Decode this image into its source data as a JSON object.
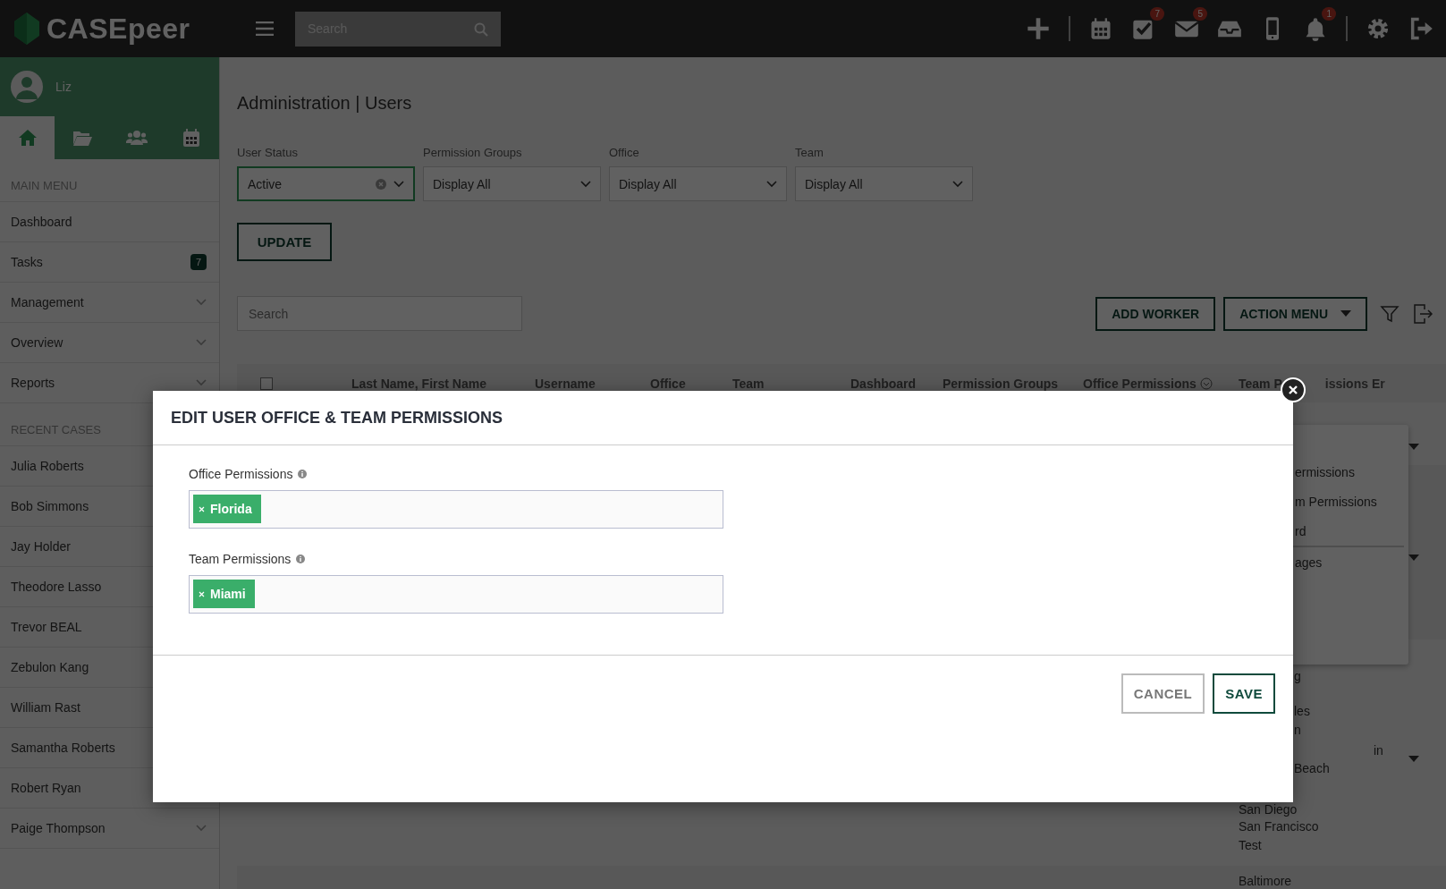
{
  "topbar": {
    "logo_text": "CASEpeer",
    "search": {
      "placeholder": "Search"
    },
    "actions": [
      {
        "kind": "add"
      },
      {
        "kind": "divider"
      },
      {
        "kind": "calendar"
      },
      {
        "kind": "tasks",
        "badge": "7"
      },
      {
        "kind": "mail",
        "badge": "5"
      },
      {
        "kind": "inbox"
      },
      {
        "kind": "phone"
      },
      {
        "kind": "bell",
        "badge": "1"
      },
      {
        "kind": "divider"
      },
      {
        "kind": "settings"
      },
      {
        "kind": "logout"
      }
    ]
  },
  "sidebar": {
    "user": "Liz",
    "tabs": [
      {
        "kind": "home",
        "selected": true
      },
      {
        "kind": "folder",
        "selected": false
      },
      {
        "kind": "people",
        "selected": false
      },
      {
        "kind": "calendar",
        "selected": false
      }
    ],
    "main_menu": {
      "heading": "MAIN MENU",
      "items": [
        {
          "label": "Dashboard",
          "expandable": false
        },
        {
          "label": "Tasks",
          "badge": "7",
          "expandable": false
        },
        {
          "label": "Management",
          "expandable": true
        },
        {
          "label": "Overview",
          "expandable": true
        },
        {
          "label": "Reports",
          "expandable": true
        }
      ]
    },
    "recent_cases": {
      "heading": "RECENT CASES",
      "items": [
        {
          "label": "Julia Roberts"
        },
        {
          "label": "Bob Simmons"
        },
        {
          "label": "Jay Holder"
        },
        {
          "label": "Theodore Lasso"
        },
        {
          "label": "Trevor BEAL"
        },
        {
          "label": "Zebulon Kang"
        },
        {
          "label": "William Rast"
        },
        {
          "label": "Samantha Roberts"
        },
        {
          "label": "Robert Ryan"
        },
        {
          "label": "Paige Thompson",
          "expandable": true
        }
      ]
    }
  },
  "page": {
    "title": "Administration | Users",
    "filters": [
      {
        "label": "User Status",
        "value": "Active",
        "clearable": true
      },
      {
        "label": "Permission Groups",
        "value": "Display All",
        "clearable": false
      },
      {
        "label": "Office",
        "value": "Display All",
        "clearable": false
      },
      {
        "label": "Team",
        "value": "Display All",
        "clearable": false
      }
    ],
    "update_button": "UPDATE",
    "search": {
      "placeholder": "Search"
    },
    "buttons": [
      {
        "label": "ADD WORKER",
        "dropdown": false
      },
      {
        "label": "ACTION MENU",
        "dropdown": true
      }
    ],
    "table": {
      "columns": [
        {
          "kind": "checkbox",
          "checked": false
        },
        {
          "label": "Last Name, First Name"
        },
        {
          "label": "Username"
        },
        {
          "label": "Office"
        },
        {
          "label": "Team"
        },
        {
          "label": "Dashboard"
        },
        {
          "label": "Permission Groups"
        },
        {
          "label": "Office Permissions",
          "sortable": true
        },
        {
          "label": "Team P",
          "label_tail": "issions"
        },
        {
          "label": "Er"
        }
      ],
      "dropdown_items": [
        {
          "label": "ermissions",
          "divider_after": false
        },
        {
          "label": "m Permissions",
          "divider_after": false
        },
        {
          "label": "rd",
          "divider_after": true
        },
        {
          "label": "ages",
          "divider_after": false
        }
      ],
      "visible_fragments": [
        "g",
        "les",
        "n",
        "in",
        "Beach",
        "San Diego",
        "San Francisco",
        "Test",
        "Baltimore"
      ]
    }
  },
  "modal": {
    "title": "EDIT USER OFFICE & TEAM PERMISSIONS",
    "fields": [
      {
        "label": "Office Permissions",
        "tags": [
          "Florida"
        ]
      },
      {
        "label": "Team Permissions",
        "tags": [
          "Miami"
        ]
      }
    ],
    "buttons": [
      {
        "label": "CANCEL",
        "kind": "secondary"
      },
      {
        "label": "SAVE",
        "kind": "primary"
      }
    ]
  }
}
